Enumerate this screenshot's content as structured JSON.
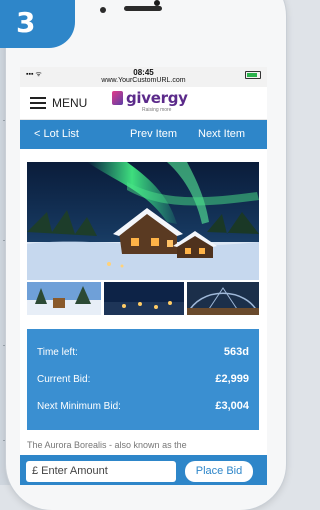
{
  "badge": {
    "number": "3"
  },
  "status_bar": {
    "time": "08:45",
    "url": "www.YourCustomURL.com"
  },
  "header": {
    "menu_label": "MENU",
    "logo_text": "givergy",
    "logo_tagline": "Raising more"
  },
  "nav": {
    "lot_list": "< Lot List",
    "prev_item": "Prev Item",
    "next_item": "Next Item"
  },
  "lot": {
    "time_left_label": "Time left:",
    "time_left_value": "563d",
    "current_bid_label": "Current Bid:",
    "current_bid_value": "£2,999",
    "next_min_bid_label": "Next Minimum Bid:",
    "next_min_bid_value": "£3,004",
    "description_snippet": "The Aurora Borealis - also known as the"
  },
  "bid": {
    "amount_placeholder": "£ Enter Amount",
    "place_bid_label": "Place Bid"
  },
  "colors": {
    "brand_blue": "#2e86c9",
    "panel_blue": "#3a8fd1",
    "logo_purple": "#5b2a8a"
  }
}
